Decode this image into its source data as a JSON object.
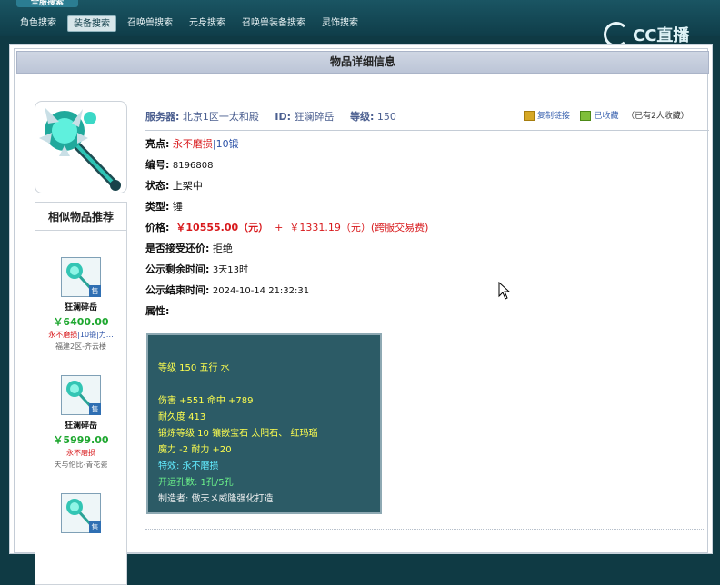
{
  "top": {
    "tab_label": "全服搜索"
  },
  "nav": {
    "items": [
      {
        "label": "角色搜索"
      },
      {
        "label": "装备搜索"
      },
      {
        "label": "召唤兽搜索"
      },
      {
        "label": "元身搜索"
      },
      {
        "label": "召唤兽装备搜索"
      },
      {
        "label": "灵饰搜索"
      }
    ],
    "active_index": 1
  },
  "watermark": {
    "text": "CC直播"
  },
  "panel": {
    "title": "物品详细信息"
  },
  "recommend": {
    "title": "相似物品推荐",
    "items": [
      {
        "name": "狂澜碎岳",
        "price": "￥6400.00",
        "tag1": "永不磨损",
        "tag2": "10锻",
        "tag3": "力…",
        "server": "福建2区-齐云楼",
        "sell": "售"
      },
      {
        "name": "狂澜碎岳",
        "price": "￥5999.00",
        "tag1": "永不磨损",
        "server": "天与伦比-青花瓷",
        "sell": "售"
      },
      {
        "name": "",
        "sell": "售"
      }
    ]
  },
  "info": {
    "server_label": "服务器:",
    "server_value": "北京1区一太和殿",
    "id_label": "ID:",
    "id_value": "狂澜碎岳",
    "level_label": "等级:",
    "level_value": "150",
    "copy_link": "复制链接",
    "favorited": "已收藏",
    "fav_count": "（已有2人收藏）"
  },
  "details": {
    "highlight_label": "亮点:",
    "highlight_value1": "永不磨损",
    "highlight_sep": "|",
    "highlight_value2": "10锻",
    "serial_label": "编号:",
    "serial_value": "8196808",
    "status_label": "状态:",
    "status_value": "上架中",
    "type_label": "类型:",
    "type_value": "锤",
    "price_label": "价格:",
    "price_value": "￥10555.00（元）",
    "price_plus": "+",
    "price_extra": "￥1331.19（元）(跨服交易费)",
    "accept_label": "是否接受还价:",
    "accept_value": "拒绝",
    "remain_label": "公示剩余时间:",
    "remain_value": "3天13时",
    "end_label": "公示结束时间:",
    "end_value": "2024-10-14 21:32:31",
    "attr_label": "属性:"
  },
  "attributes": {
    "line1": "等级 150 五行 水",
    "line2": "伤害 +551 命中 +789",
    "line3": "耐久度 413",
    "line4": "锻炼等级 10 镶嵌宝石 太阳石、 红玛瑙",
    "line5": "魔力 -2 耐力 +20",
    "line6": "特效: 永不磨损",
    "line7": "开运孔数: 1孔/5孔",
    "line8": "制造者: 傲天メ威隆强化打造"
  }
}
